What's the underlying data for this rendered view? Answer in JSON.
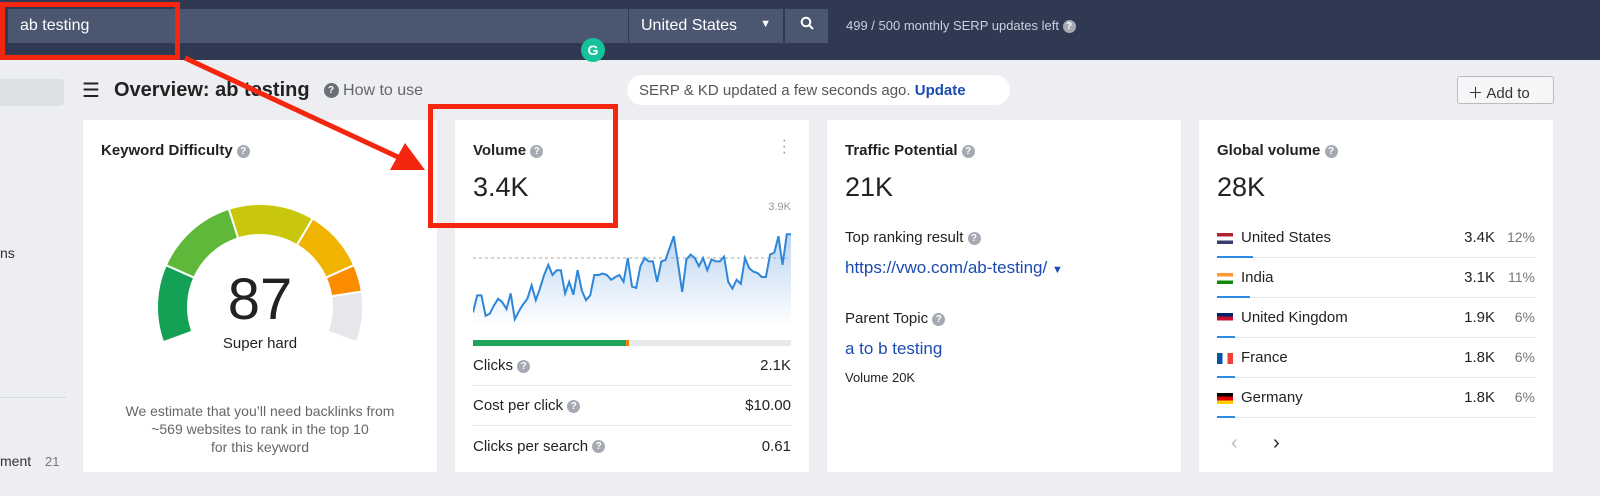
{
  "topbar": {
    "search_value": "ab testing",
    "country": "United States",
    "serp_updates": "499 / 500 monthly SERP updates left"
  },
  "sidebar": {
    "fragment_1": "ns",
    "fragment_2": "ment",
    "fragment_2_count": "21"
  },
  "header": {
    "title": "Overview: ab testing",
    "how_to_use": "How to use",
    "status": "SERP & KD updated a few seconds ago.",
    "update": "Update",
    "add_to": "Add to"
  },
  "kd": {
    "title": "Keyword Difficulty",
    "value": "87",
    "score": 87,
    "label": "Super hard",
    "note": [
      "We estimate that you’ll need backlinks from",
      "~569 websites to rank in the top 10",
      "for this keyword"
    ],
    "colors": [
      "#14a055",
      "#5fb83a",
      "#c9c70b",
      "#f0b400",
      "#fb8c00",
      "#e6e7ea"
    ]
  },
  "volume": {
    "title": "Volume",
    "value": "3.4K",
    "max_label": "3.9K",
    "clicks_split": {
      "organic_pct": 48,
      "paid_pct": 1.2
    },
    "sparkline": [
      2.6,
      2.85,
      2.85,
      2.55,
      2.58,
      2.7,
      2.8,
      2.75,
      2.65,
      2.88,
      2.5,
      2.62,
      2.72,
      2.8,
      3.0,
      2.78,
      2.95,
      3.15,
      3.3,
      3.15,
      3.22,
      3.22,
      2.88,
      3.05,
      2.86,
      3.22,
      2.92,
      2.78,
      2.85,
      3.15,
      3.15,
      3.17,
      3.15,
      3.08,
      3.12,
      3.15,
      3.05,
      3.4,
      2.98,
      2.96,
      3.28,
      3.4,
      3.35,
      3.35,
      3.05,
      3.35,
      3.37,
      3.55,
      3.72,
      3.32,
      2.9,
      3.38,
      3.45,
      3.4,
      3.28,
      3.4,
      3.22,
      3.38,
      3.35,
      3.35,
      3.42,
      3.05,
      2.95,
      3.08,
      3.02,
      3.4,
      3.25,
      3.2,
      3.18,
      3.12,
      3.12,
      3.45,
      3.48,
      3.72,
      3.3,
      3.75,
      3.75
    ],
    "rows": [
      {
        "label": "Clicks",
        "value": "2.1K"
      },
      {
        "label": "Cost per click",
        "value": "$10.00"
      },
      {
        "label": "Clicks per search",
        "value": "0.61"
      }
    ]
  },
  "traffic": {
    "title": "Traffic Potential",
    "value": "21K",
    "top_label": "Top ranking result",
    "top_url": "https://vwo.com/ab-testing/",
    "parent_label": "Parent Topic",
    "parent_topic": "a to b testing",
    "parent_volume": "Volume 20K"
  },
  "global": {
    "title": "Global volume",
    "value": "28K",
    "countries": [
      {
        "name": "United States",
        "volume": "3.4K",
        "pct": "12%",
        "share": 12
      },
      {
        "name": "India",
        "volume": "3.1K",
        "pct": "11%",
        "share": 11
      },
      {
        "name": "United Kingdom",
        "volume": "1.9K",
        "pct": "6%",
        "share": 6
      },
      {
        "name": "France",
        "volume": "1.8K",
        "pct": "6%",
        "share": 6
      },
      {
        "name": "Germany",
        "volume": "1.8K",
        "pct": "6%",
        "share": 6
      }
    ]
  }
}
